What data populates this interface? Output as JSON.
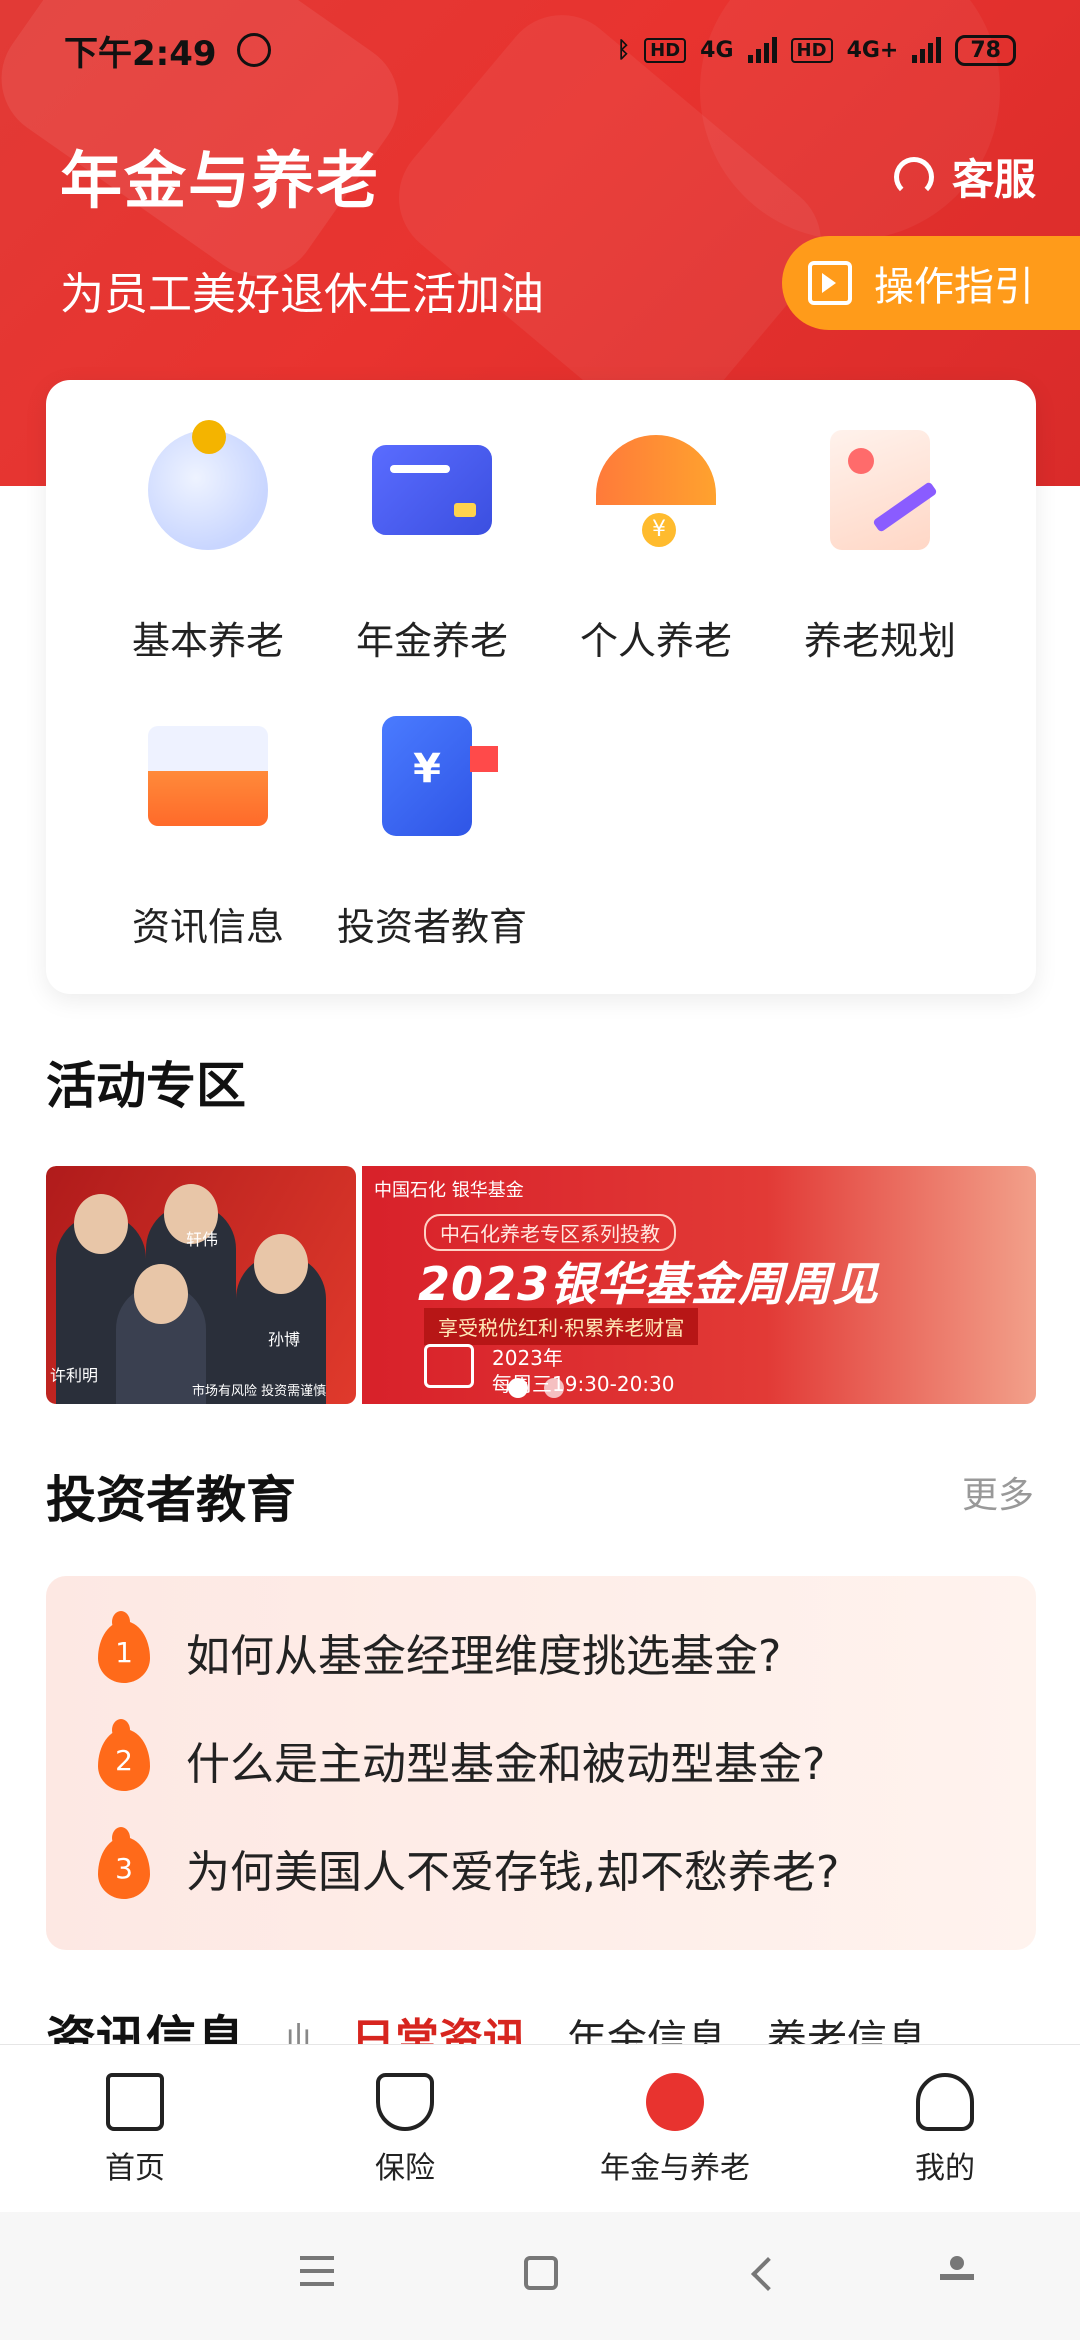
{
  "status": {
    "time": "下午2:49",
    "battery": "78",
    "network1": "4G",
    "network2": "4G+",
    "hd": "HD"
  },
  "header": {
    "title": "年金与养老",
    "subtitle": "为员工美好退休生活加油",
    "service_label": "客服",
    "guide_label": "操作指引"
  },
  "grid": [
    {
      "label": "基本养老",
      "icon": "piggy-bank-icon"
    },
    {
      "label": "年金养老",
      "icon": "card-icon"
    },
    {
      "label": "个人养老",
      "icon": "umbrella-icon"
    },
    {
      "label": "养老规划",
      "icon": "plan-icon"
    },
    {
      "label": "资讯信息",
      "icon": "mail-icon"
    },
    {
      "label": "投资者教育",
      "icon": "book-icon"
    }
  ],
  "activity": {
    "title": "活动专区",
    "banner": {
      "names": [
        "轩伟",
        "许利明",
        "孙博"
      ],
      "risk_note": "市场有风险 投资需谨慎",
      "logo": "中国石化 银华基金",
      "tag": "中石化养老专区系列投教",
      "headline": "2023银华基金周周见",
      "slogan": "享受税优红利·积累养老财富",
      "year": "2023年",
      "schedule": "每周三19:30-20:30"
    }
  },
  "education": {
    "title": "投资者教育",
    "more": "更多",
    "items": [
      {
        "rank": "1",
        "text": "如何从基金经理维度挑选基金?"
      },
      {
        "rank": "2",
        "text": "什么是主动型基金和被动型基金?"
      },
      {
        "rank": "3",
        "text": "为何美国人不爱存钱,却不愁养老?"
      }
    ]
  },
  "info": {
    "title": "资讯信息",
    "tabs": [
      "日常资讯",
      "年金信息",
      "养老信息"
    ]
  },
  "nav": [
    {
      "label": "首页",
      "icon": "home-icon"
    },
    {
      "label": "保险",
      "icon": "shield-icon"
    },
    {
      "label": "年金与养老",
      "icon": "pension-icon"
    },
    {
      "label": "我的",
      "icon": "user-icon"
    }
  ],
  "colors": {
    "brand_red": "#e8332f",
    "accent_orange": "#ff9b1a",
    "active_tab": "#d7251f"
  }
}
